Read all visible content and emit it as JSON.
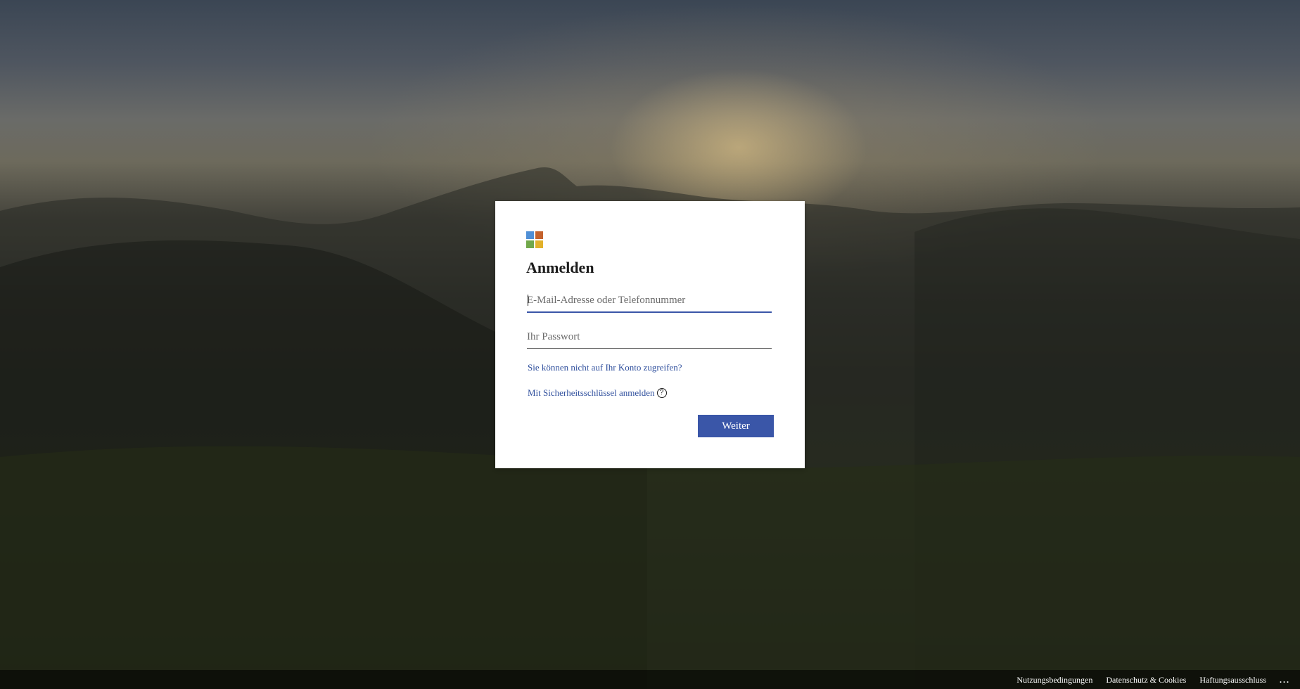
{
  "signin": {
    "title": "Anmelden",
    "logo_icon": "microsoft-logo-icon",
    "email_placeholder": "E-Mail-Adresse oder Telefonnummer",
    "email_value": "",
    "password_placeholder": "Ihr Passwort",
    "password_value": "",
    "forgot_link": "Sie können nicht auf Ihr Konto zugreifen?",
    "security_key_link": "Mit Sicherheitsschlüssel anmelden",
    "help_icon": "question-circle-icon",
    "help_glyph": "?",
    "next_button": "Weiter"
  },
  "footer": {
    "terms": "Nutzungsbedingungen",
    "privacy": "Datenschutz & Cookies",
    "disclaimer": "Haftungsausschluss",
    "more": "..."
  },
  "colors": {
    "accent": "#3a56a8",
    "link": "#2f4f9d",
    "card_background": "#ffffff",
    "logo": [
      "#4f8fd6",
      "#c4622d",
      "#71a84a",
      "#e2b12a"
    ]
  }
}
